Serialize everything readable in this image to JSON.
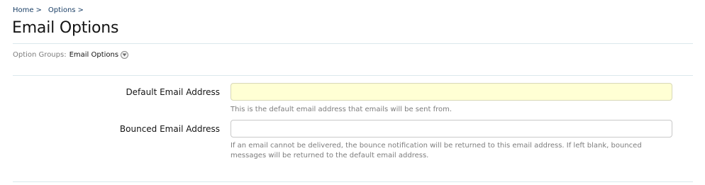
{
  "breadcrumb": {
    "items": [
      {
        "label": "Home",
        "separator": ">"
      },
      {
        "label": "Options",
        "separator": ">"
      }
    ]
  },
  "page": {
    "title": "Email Options"
  },
  "option_groups": {
    "label": "Option Groups:",
    "selected": "Email Options",
    "toggle_icon": "chevron-down-circle-icon"
  },
  "fields": [
    {
      "label": "Default Email Address",
      "value": "",
      "focused": true,
      "hint": "This is the default email address that emails will be sent from."
    },
    {
      "label": "Bounced Email Address",
      "value": "",
      "focused": false,
      "hint_line1": "If an email cannot be delivered, the bounce notification will be returned to this email address. If left blank, bounced",
      "hint_line2": "messages will be returned to the default email address."
    }
  ],
  "colors": {
    "link": "#1a3f66",
    "focused_input_bg": "#ffffd4",
    "divider": "#dbe8ec",
    "muted_text": "#7d7d7d"
  }
}
